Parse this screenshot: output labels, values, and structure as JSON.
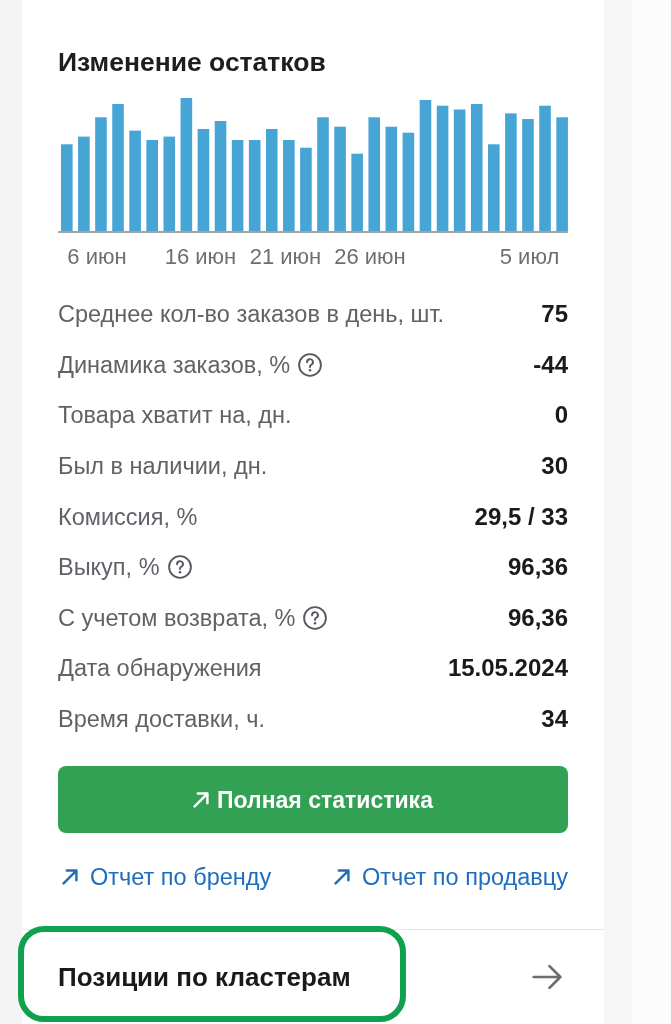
{
  "stock_chart": {
    "title": "Изменение остатков",
    "x_labels": [
      "6 июн",
      "16 июн",
      "21 июн",
      "26 июн",
      "5 июл"
    ]
  },
  "stats": [
    {
      "label": "Среднее кол-во заказов в день, шт.",
      "value": "75",
      "hint": false
    },
    {
      "label": "Динамика заказов, %",
      "value": "-44",
      "hint": true
    },
    {
      "label": "Товара хватит на, дн.",
      "value": "0",
      "hint": false
    },
    {
      "label": "Был в наличии, дн.",
      "value": "30",
      "hint": false
    },
    {
      "label": "Комиссия, %",
      "value": "29,5 / 33",
      "hint": false
    },
    {
      "label": "Выкуп, %",
      "value": "96,36",
      "hint": true
    },
    {
      "label": "С учетом возврата, %",
      "value": "96,36",
      "hint": true
    },
    {
      "label": "Дата обнаружения",
      "value": "15.05.2024",
      "hint": false
    },
    {
      "label": "Время доставки, ч.",
      "value": "34",
      "hint": false
    }
  ],
  "full_stats_button": {
    "label": "Полная статистика"
  },
  "links": [
    {
      "label": "Отчет по бренду"
    },
    {
      "label": "Отчет по продавцу"
    }
  ],
  "clusters_section": {
    "title": "Позиции по кластерам",
    "highlighted": true
  }
}
